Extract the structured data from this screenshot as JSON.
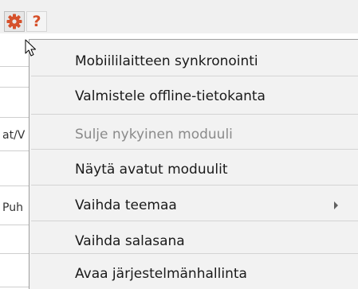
{
  "toolbar": {
    "settings_icon": "gear-icon",
    "help_icon": "question-mark-icon",
    "help_label": "?",
    "colors": {
      "icon_accent": "#d6512b",
      "toolbar_bg": "#f0f0f0"
    }
  },
  "background": {
    "cells": [
      "at/V",
      "Puh"
    ]
  },
  "context_menu": {
    "items": [
      {
        "label": "Mobiililaitteen synkronointi",
        "enabled": true
      },
      {
        "label": "Valmistele offline-tietokanta",
        "enabled": true
      },
      {
        "label": "Sulje nykyinen moduuli",
        "enabled": false
      },
      {
        "label": "Näytä avatut moduulit",
        "enabled": true
      },
      {
        "label": "Vaihda teemaa",
        "enabled": true,
        "has_submenu": true
      },
      {
        "label": "Vaihda salasana",
        "enabled": true
      },
      {
        "label": "Avaa järjestelmänhallinta",
        "enabled": true
      }
    ],
    "colors": {
      "background": "#f2f2f2",
      "text": "#1a1a1a",
      "disabled_text": "#8a8a8a",
      "separator": "#d4d4d4"
    }
  }
}
